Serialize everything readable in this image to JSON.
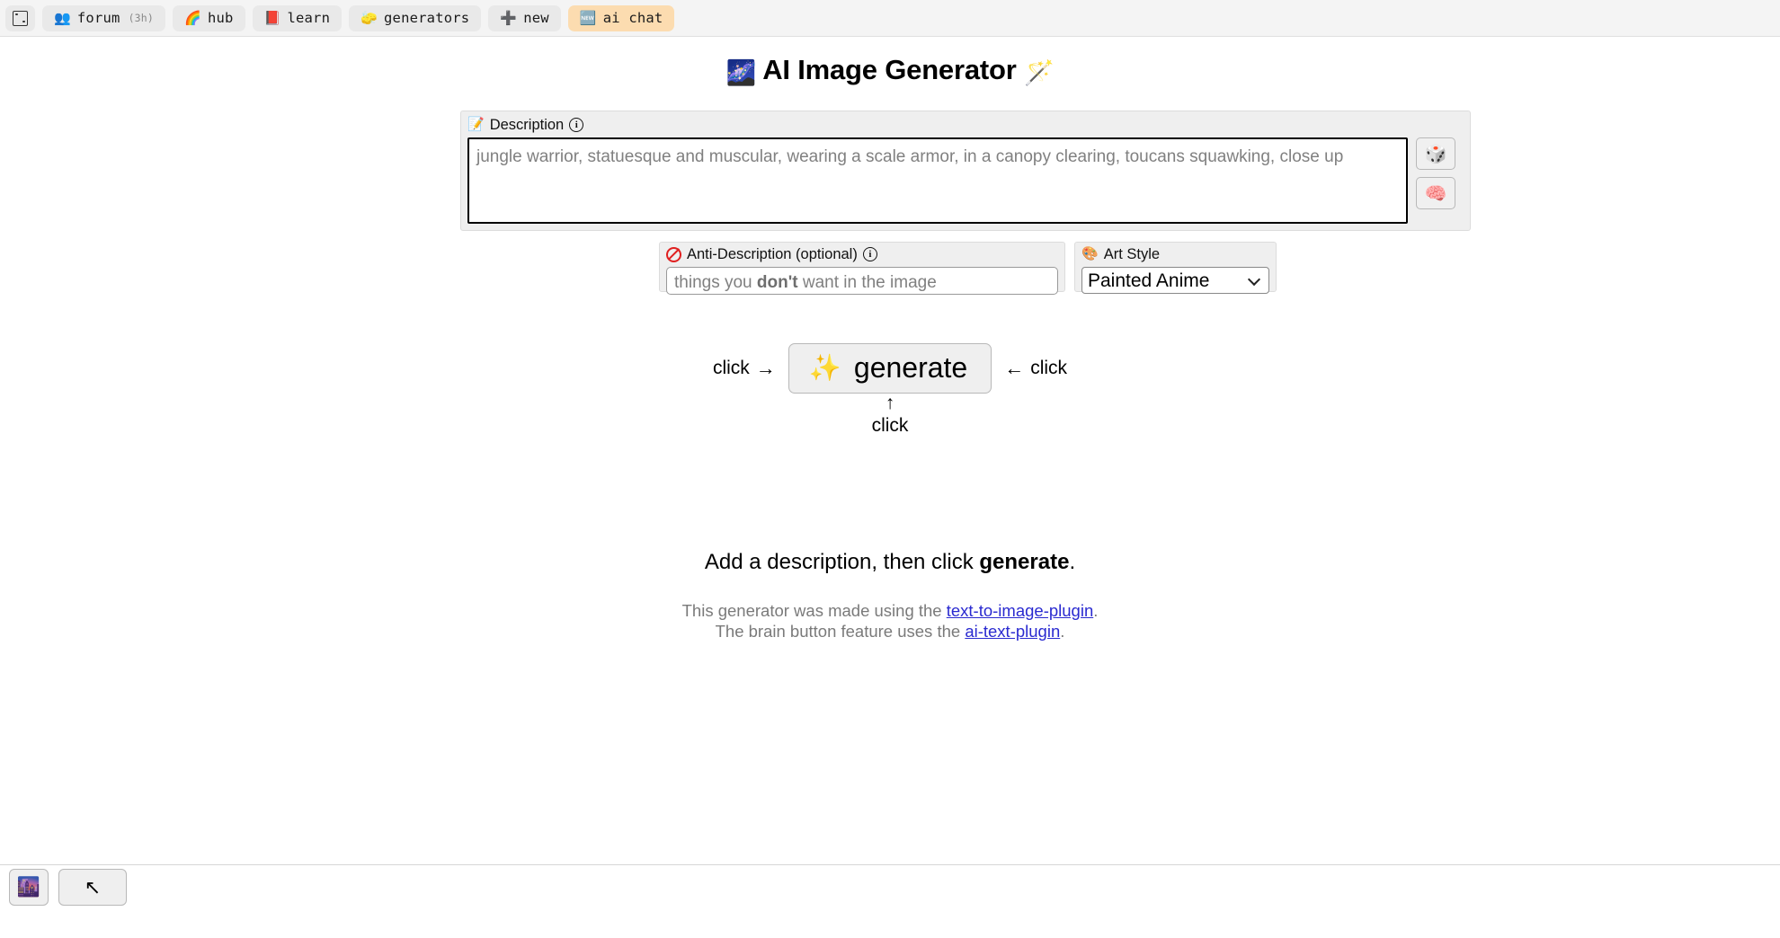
{
  "topbar": {
    "tabs": [
      {
        "icon": "dice-box-icon",
        "label": "",
        "sub": "",
        "highlight": false
      },
      {
        "icon": "busts-icon",
        "glyph": "👥",
        "label": "forum",
        "sub": "(3h)",
        "highlight": false
      },
      {
        "icon": "rainbow-icon",
        "glyph": "🌈",
        "label": "hub",
        "sub": "",
        "highlight": false
      },
      {
        "icon": "books-icon",
        "glyph": "📕",
        "label": "learn",
        "sub": "",
        "highlight": false
      },
      {
        "icon": "sponge-icon",
        "glyph": "🧽",
        "label": "generators",
        "sub": "",
        "highlight": false
      },
      {
        "icon": "plus-icon",
        "glyph": "➕",
        "label": "new",
        "sub": "",
        "highlight": false
      },
      {
        "icon": "new-badge-icon",
        "glyph": "🆕",
        "label": "ai chat",
        "sub": "",
        "highlight": true
      }
    ]
  },
  "header": {
    "emoji_left": "🌌",
    "title": "AI Image Generator",
    "emoji_right": "🪄"
  },
  "description": {
    "label": "Description",
    "label_emoji": "📝",
    "info": "i",
    "placeholder": "jungle warrior, statuesque and muscular, wearing a scale armor, in a canopy clearing, toucans squawking, close up",
    "value": "",
    "buttons": [
      {
        "name": "randomize-button",
        "glyph": "🎲"
      },
      {
        "name": "brain-button",
        "glyph": "🧠"
      }
    ]
  },
  "anti_description": {
    "label": "Anti-Description (optional)",
    "info": "i",
    "placeholder_pre": "things you ",
    "placeholder_bold": "don't",
    "placeholder_post": " want in the image",
    "placeholder": "things you don't want in the image",
    "value": ""
  },
  "art_style": {
    "label": "Art Style",
    "label_emoji": "🎨",
    "selected": "Painted Anime",
    "options": [
      "Painted Anime"
    ]
  },
  "generate": {
    "hint_left": "click",
    "arrow_left": "→",
    "spark": "✨",
    "label": "generate",
    "arrow_right": "←",
    "hint_right": "click",
    "arrow_up": "↑",
    "hint_below": "click"
  },
  "status": {
    "pre": "Add a description, then click ",
    "bold": "generate",
    "post": "."
  },
  "credits": {
    "line1_pre": "This generator was made using the ",
    "line1_link": "text-to-image-plugin",
    "line1_post": ".",
    "line2_pre": "The brain button feature uses the ",
    "line2_link": "ai-text-plugin",
    "line2_post": "."
  },
  "bottom": {
    "theme_glyph": "🌆",
    "cursor_glyph": "↖"
  },
  "colors": {
    "tab_bg": "#e9e9e9",
    "tab_highlight": "#fcdcb0",
    "panel_bg": "#efefef",
    "link": "#2a2ad0",
    "placeholder": "#808080",
    "anti_red": "#e02020"
  }
}
